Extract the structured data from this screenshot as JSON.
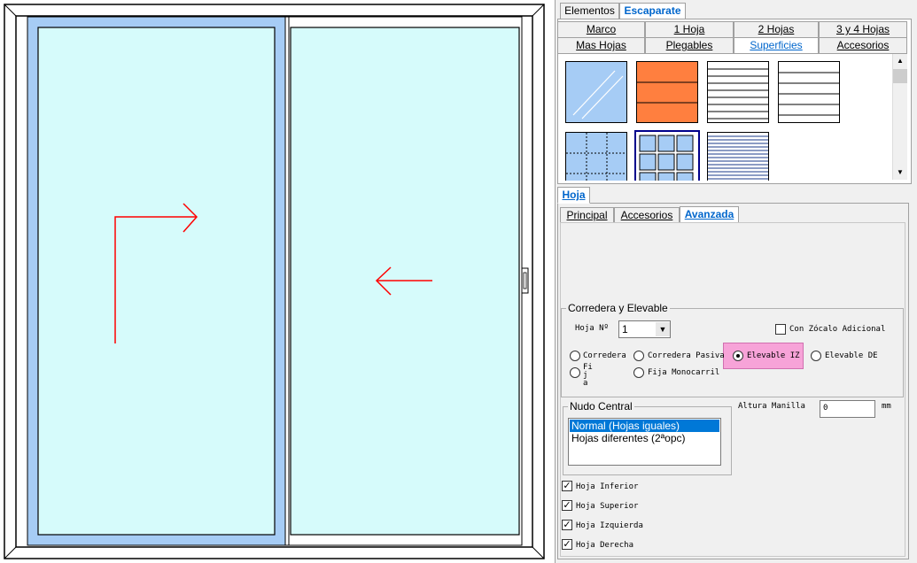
{
  "top_tabs": [
    "Elementos",
    "Escaparate"
  ],
  "catalog_tabs_row1": [
    "Marco",
    "1 Hoja",
    "2 Hojas",
    "3 y 4 Hojas"
  ],
  "catalog_tabs_row2": [
    "Mas Hojas",
    "Plegables",
    "Superficies",
    "Accesorios"
  ],
  "hoja_tab": "Hoja",
  "sub_tabs": [
    "Principal",
    "Accesorios",
    "Avanzada"
  ],
  "corredera": {
    "group_label": "Corredera y Elevable",
    "hoja_label": "Hoja Nº",
    "hoja_value": "1",
    "zocalo_label": "Con Zócalo Adicional",
    "options": [
      "Corredera",
      "Corredera Pasiva",
      "Elevable IZ",
      "Elevable DE",
      "Fij a",
      "Fija Monocarril"
    ],
    "selected": "Elevable IZ"
  },
  "nudo": {
    "group_label": "Nudo Central",
    "items": [
      "Normal (Hojas iguales)",
      "Hojas diferentes (2ªopc)"
    ],
    "selected": "Normal (Hojas iguales)"
  },
  "altura": {
    "label": "Altura Manilla",
    "value": "0",
    "unit": "mm"
  },
  "checkboxes": [
    "Hoja Inferior",
    "Hoja Superior",
    "Hoja Izquierda",
    "Hoja Derecha"
  ],
  "colors": {
    "glass": "#d6fbfb",
    "selected_sash": "#a6ccf5",
    "accent": "#0066cc",
    "highlight": "#f7a3d8",
    "arrow": "#ff0000",
    "orange": "#ff7f3f",
    "list_selection": "#0078d7"
  }
}
